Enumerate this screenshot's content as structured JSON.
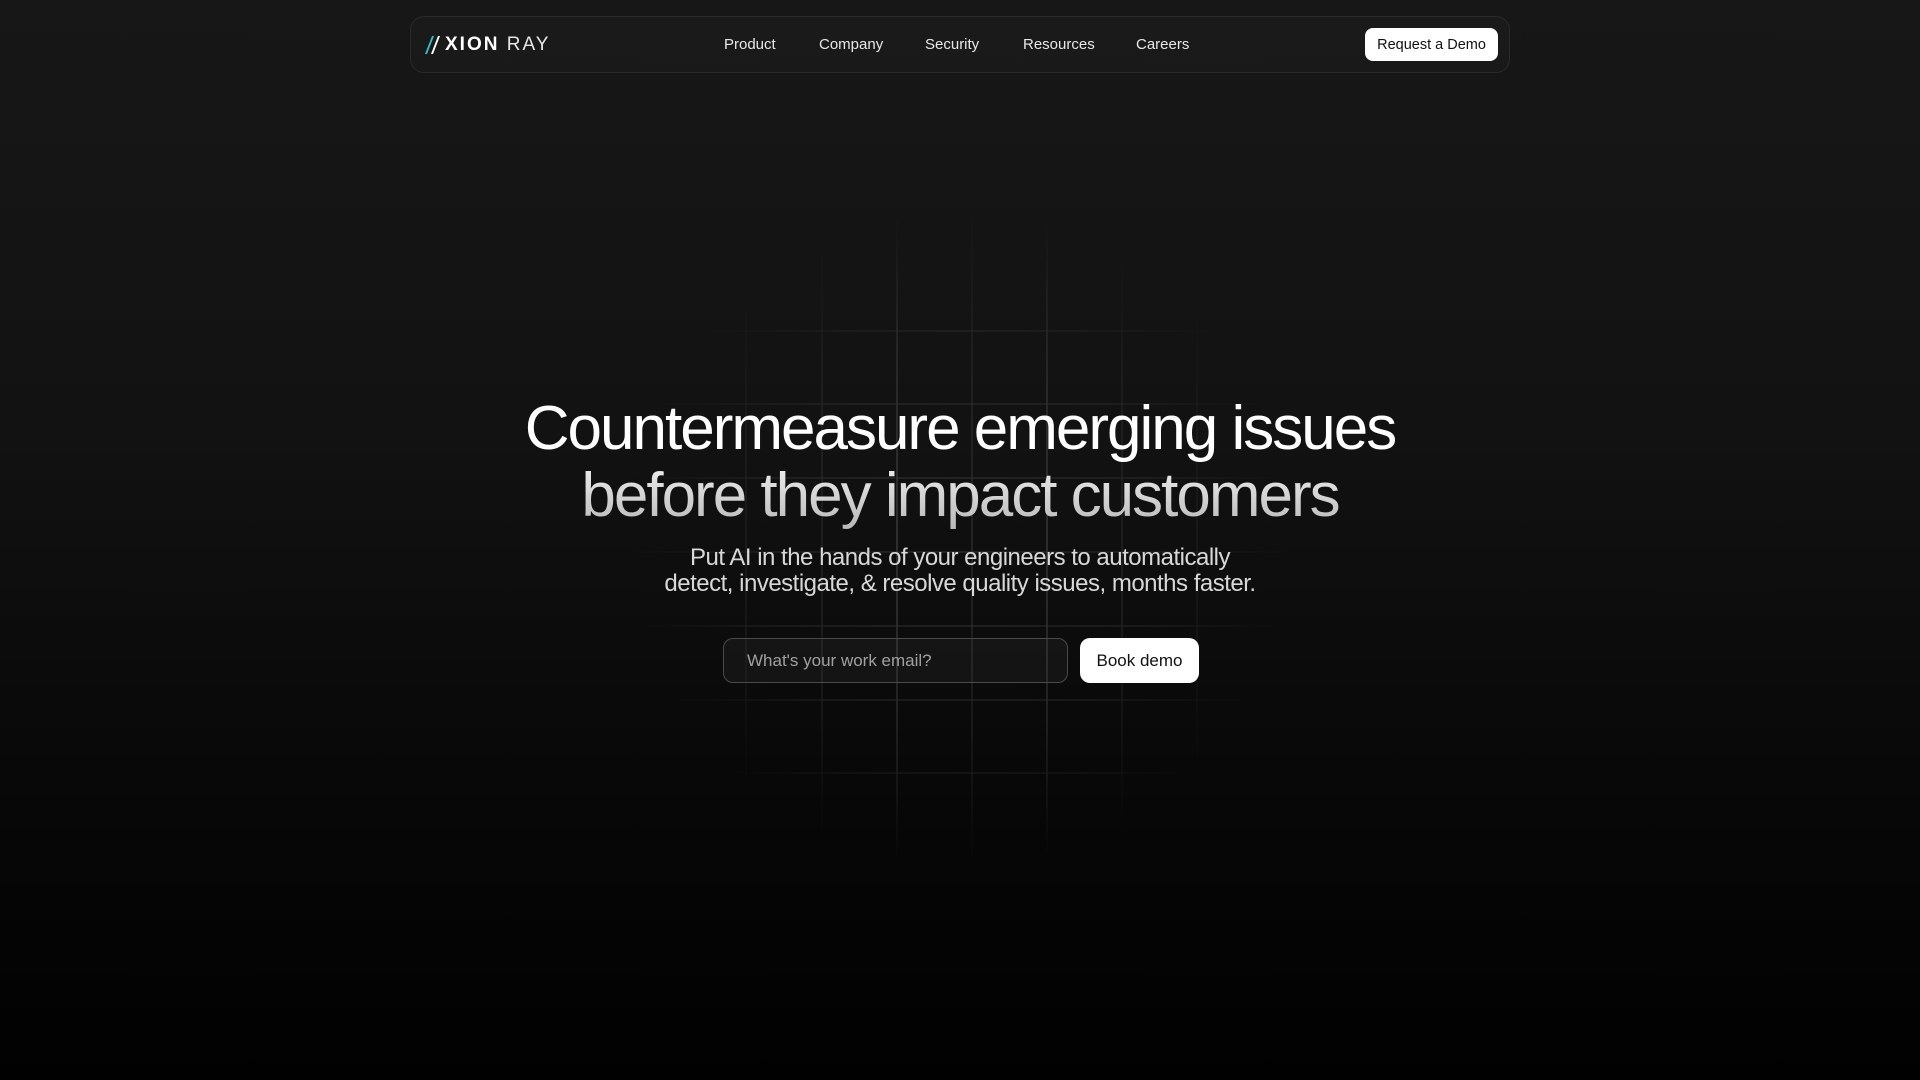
{
  "logo": {
    "text_bold": "XION",
    "text_light": "RAY"
  },
  "nav": {
    "items": [
      {
        "label": "Product"
      },
      {
        "label": "Company"
      },
      {
        "label": "Security"
      },
      {
        "label": "Resources"
      },
      {
        "label": "Careers"
      }
    ],
    "cta_label": "Request a Demo"
  },
  "hero": {
    "title_line1": "Countermeasure emerging issues",
    "title_line2": "before they impact customers",
    "subtitle_line1": "Put AI in the hands of your engineers to automatically",
    "subtitle_line2": "detect, investigate, & resolve quality issues, months faster.",
    "email_placeholder": "What's your work email?",
    "book_label": "Book demo"
  },
  "colors": {
    "background_top": "#171717",
    "background_bottom": "#010101",
    "logo_accent": "#2ec4c4",
    "button_bg": "#ffffff",
    "button_text": "#111111"
  }
}
